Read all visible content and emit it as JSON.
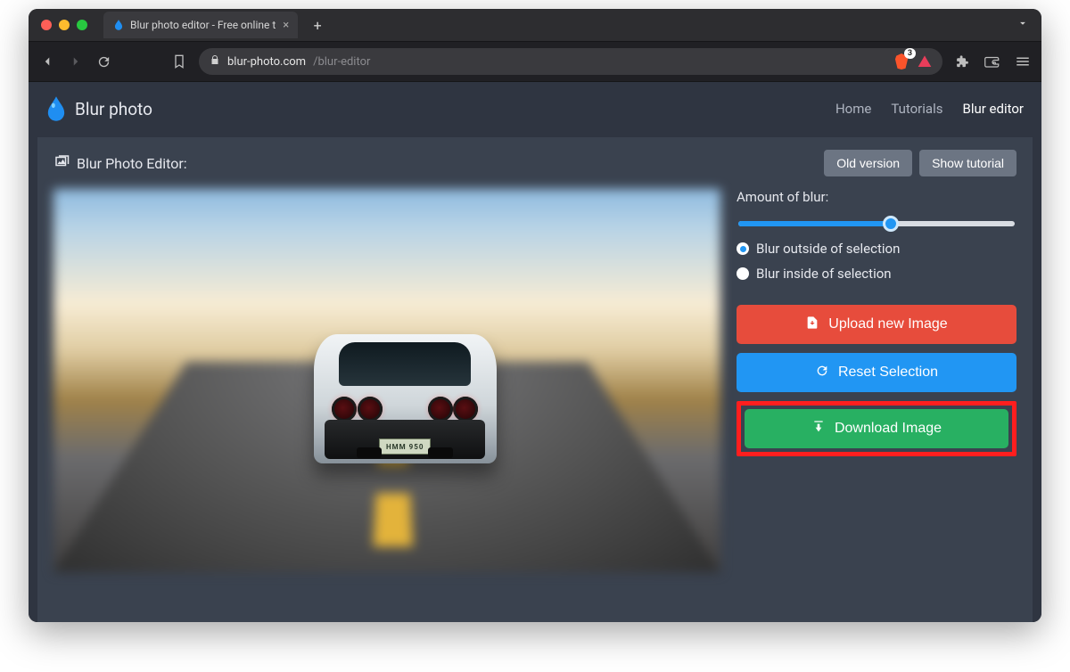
{
  "browser": {
    "tab_title": "Blur photo editor - Free online t",
    "url_domain": "blur-photo.com",
    "url_path": "/blur-editor",
    "brave_count": "3"
  },
  "header": {
    "brand": "Blur photo",
    "nav": {
      "home": "Home",
      "tutorials": "Tutorials",
      "editor": "Blur editor"
    }
  },
  "editor": {
    "title": "Blur Photo Editor:",
    "buttons": {
      "old_version": "Old version",
      "show_tutorial": "Show tutorial"
    },
    "controls": {
      "amount_label": "Amount of blur:",
      "radio_outside": "Blur outside of selection",
      "radio_inside": "Blur inside of selection",
      "upload": "Upload new Image",
      "reset": "Reset Selection",
      "download": "Download Image"
    },
    "car_plate": "HMM 950"
  }
}
